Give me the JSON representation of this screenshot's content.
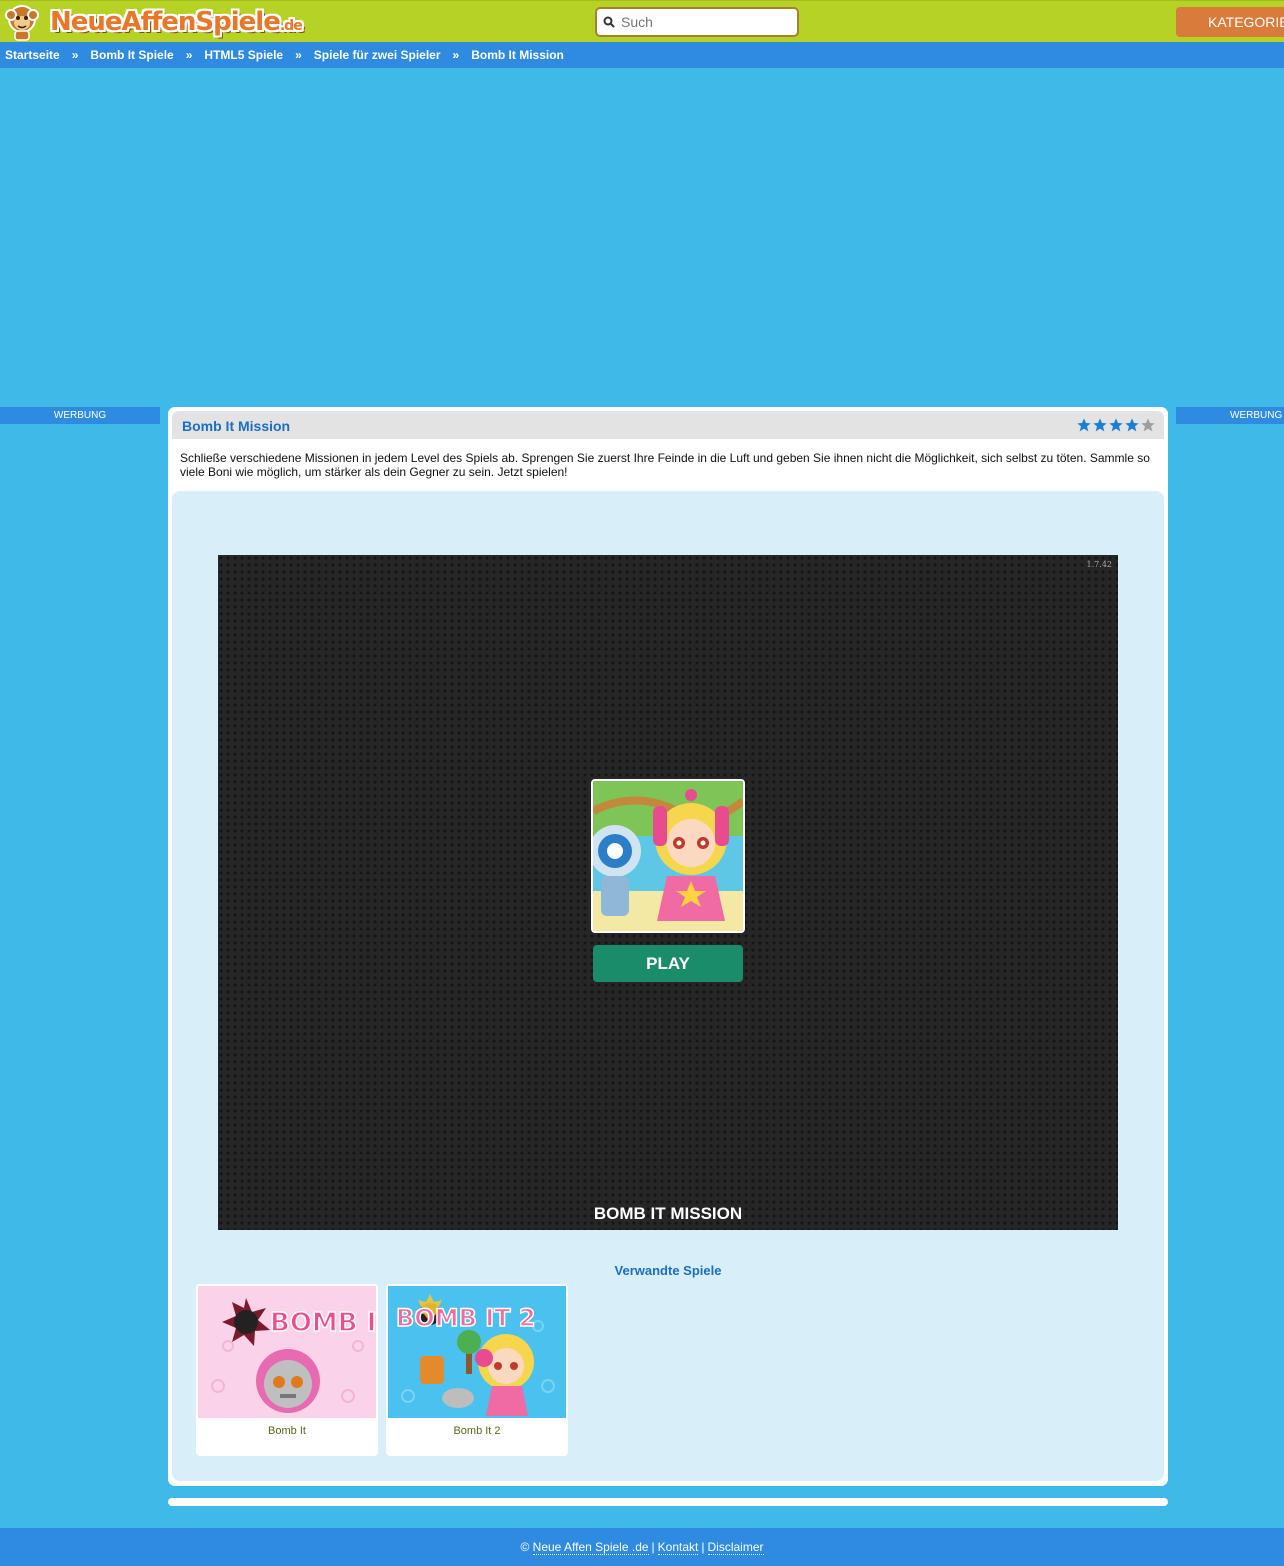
{
  "header": {
    "logo_text": "NeueAffenSpiele",
    "logo_suffix": ".de",
    "search_placeholder": "Such",
    "categories_label": "KATEGORIEN"
  },
  "breadcrumb": {
    "items": [
      "Startseite",
      "Bomb It Spiele",
      "HTML5 Spiele",
      "Spiele für zwei Spieler",
      "Bomb It Mission"
    ],
    "separator": "»"
  },
  "ads": {
    "left_label": "WERBUNG",
    "right_label": "WERBUNG"
  },
  "game": {
    "title": "Bomb It Mission",
    "rating": 4,
    "rating_max": 5,
    "description": "Schließe verschiedene Missionen in jedem Level des Spiels ab. Sprengen Sie zuerst Ihre Feinde in die Luft und geben Sie ihnen nicht die Möglichkeit, sich selbst zu töten. Sammle so viele Boni wie möglich, um stärker als dein Gegner zu sein. Jetzt spielen!",
    "version": "1.7.42",
    "play_label": "PLAY",
    "splash_title": "BOMB IT MISSION"
  },
  "related": {
    "heading": "Verwandte Spiele",
    "games": [
      {
        "name": "Bomb It",
        "logo": "BOMB IT"
      },
      {
        "name": "Bomb It 2",
        "logo": "BOMB IT 2"
      }
    ]
  },
  "footer": {
    "copyright": "©",
    "site_link": "Neue Affen Spiele .de",
    "contact_link": "Kontakt",
    "disclaimer_link": "Disclaimer",
    "separator": "|"
  },
  "colors": {
    "page_bg": "#3eb9e8",
    "header_bg": "#b7d226",
    "nav_bg": "#2f8be0",
    "accent_orange": "#d97b3a",
    "title_blue": "#1a6fc4",
    "play_green": "#1b8c6a"
  }
}
